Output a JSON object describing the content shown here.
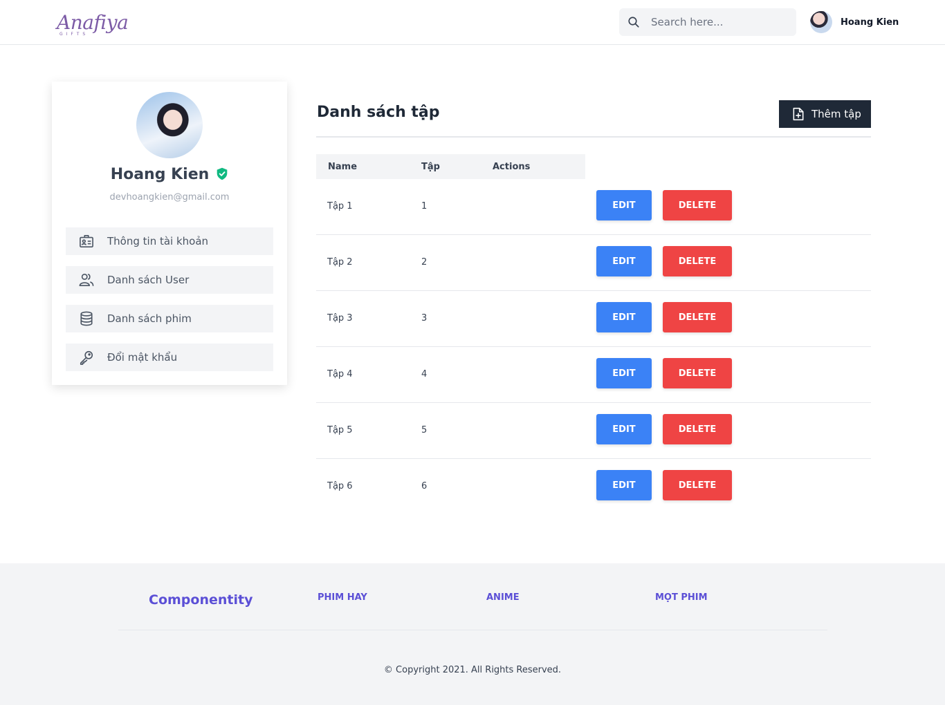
{
  "header": {
    "logo_text": "Anafiya",
    "logo_sub": "GIFTS",
    "search_placeholder": "Search here...",
    "user_name": "Hoang Kien"
  },
  "profile": {
    "name": "Hoang Kien",
    "email": "devhoangkien@gmail.com",
    "menu": [
      {
        "label": "Thông tin tài khoản",
        "icon": "id-card-icon"
      },
      {
        "label": "Danh sách User",
        "icon": "users-icon"
      },
      {
        "label": "Danh sách phim",
        "icon": "database-icon"
      },
      {
        "label": "Đổi mật khẩu",
        "icon": "key-icon"
      }
    ]
  },
  "main": {
    "title": "Danh sách tập",
    "add_button": "Thêm tập",
    "columns": [
      "Name",
      "Tập",
      "Actions"
    ],
    "edit_label": "EDIT",
    "delete_label": "DELETE",
    "rows": [
      {
        "name": "Tập 1",
        "episode": "1"
      },
      {
        "name": "Tập 2",
        "episode": "2"
      },
      {
        "name": "Tập 3",
        "episode": "3"
      },
      {
        "name": "Tập 4",
        "episode": "4"
      },
      {
        "name": "Tập 5",
        "episode": "5"
      },
      {
        "name": "Tập 6",
        "episode": "6"
      }
    ]
  },
  "footer": {
    "brand": "Componentity",
    "links": [
      "PHIM HAY",
      "ANIME",
      "MỌT PHIM"
    ],
    "copyright": "© Copyright 2021. All Rights Reserved."
  },
  "colors": {
    "edit": "#3b82f6",
    "delete": "#ef4444",
    "dark_button": "#1f2937",
    "footer_link": "#5b4fd6",
    "verified": "#10b981"
  }
}
